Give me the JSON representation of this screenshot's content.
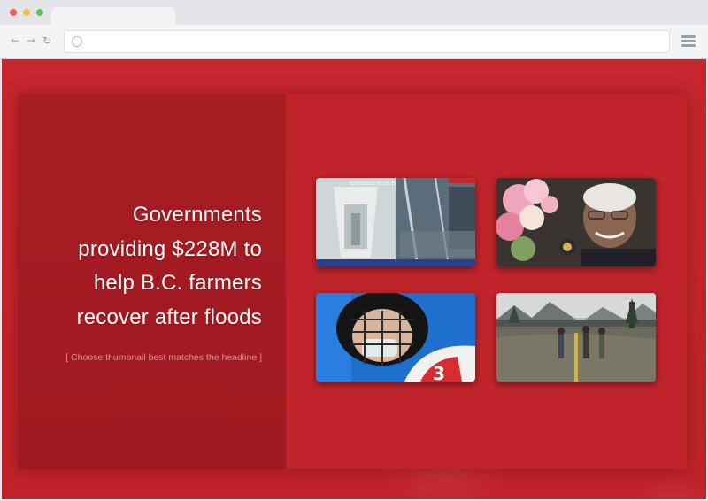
{
  "browser": {
    "window_controls": {
      "close_color": "#ed5e57",
      "minimize_color": "#f5bf40",
      "maximize_color": "#5ac45a"
    },
    "address_bar": {
      "value": "",
      "icon": "globe-icon"
    },
    "nav": {
      "back_icon": "←",
      "forward_icon": "→",
      "reload_icon": "↻"
    },
    "menu_icon": "hamburger-menu-icon"
  },
  "page": {
    "headline_lines": [
      "Governments",
      "providing $228M to",
      "help B.C. farmers",
      "recover after floods"
    ],
    "instruction": "[ Choose thumbnail best matches the headline ]",
    "accent_color": "#c0222a",
    "thumbnails": [
      {
        "id": "security-camera-hallway",
        "description": "security camera footage of an elevator hallway",
        "overlay_text": "02/08/2022 05:23:35"
      },
      {
        "id": "elderly-woman-medal",
        "description": "smiling elderly woman holding a medal with flowers"
      },
      {
        "id": "hockey-player",
        "description": "hockey player wearing a cage helmet and face mask, jersey number 3",
        "jersey_number": "3"
      },
      {
        "id": "flooded-farmland",
        "description": "people standing in floodwater on a flooded road"
      }
    ]
  }
}
